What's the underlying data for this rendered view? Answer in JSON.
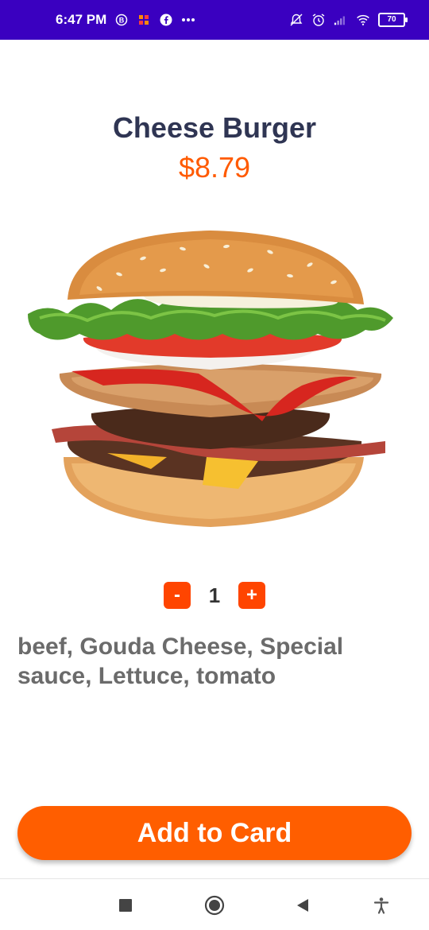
{
  "status_bar": {
    "time": "6:47 PM",
    "battery": "70",
    "left_icons": [
      "b-circle-icon",
      "app-icon",
      "facebook-icon",
      "more-icon"
    ],
    "right_icons": [
      "mute-bell-icon",
      "alarm-icon",
      "signal-icon",
      "wifi-icon",
      "battery-icon"
    ]
  },
  "product": {
    "name": "Cheese Burger",
    "price": "$8.79",
    "description": "beef, Gouda Cheese, Special sauce, Lettuce, tomato"
  },
  "quantity": {
    "decrement_label": "-",
    "value": "1",
    "increment_label": "+"
  },
  "cta": {
    "label": "Add to Card"
  },
  "colors": {
    "accent": "#ff5e00",
    "title": "#2f3553",
    "status_bar": "#3a00c0"
  },
  "nav_bar": {
    "items": [
      "recents-icon",
      "home-icon",
      "back-icon",
      "accessibility-icon"
    ]
  }
}
